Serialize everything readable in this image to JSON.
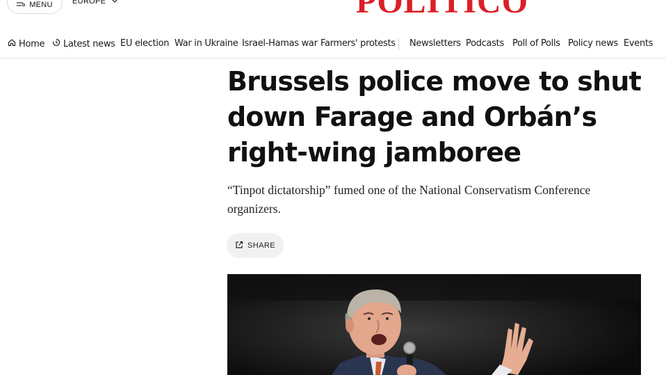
{
  "header": {
    "menu_label": "MENU",
    "region_label": "EUROPE",
    "logo_text": "POLITICO",
    "brand_color": "#dc1f26"
  },
  "nav": {
    "items": [
      {
        "label": "Home",
        "icon": "home-icon"
      },
      {
        "label": "Latest news",
        "icon": "clock-icon"
      },
      {
        "label": "EU election"
      },
      {
        "label": "War in Ukraine"
      },
      {
        "label": "Israel-Hamas war"
      },
      {
        "label": "Farmers' protests"
      },
      {
        "label": "Newsletters"
      },
      {
        "label": "Podcasts"
      },
      {
        "label": "Poll of Polls"
      },
      {
        "label": "Policy news"
      },
      {
        "label": "Events"
      }
    ]
  },
  "article": {
    "headline": "Brussels police move to shut down Farage and Orbán’s right-wing jamboree",
    "dek": "“Tinpot dictatorship” fumed one of the National Conservatism Conference organizers.",
    "share_label": "SHARE",
    "share_icon": "external-link-icon"
  }
}
